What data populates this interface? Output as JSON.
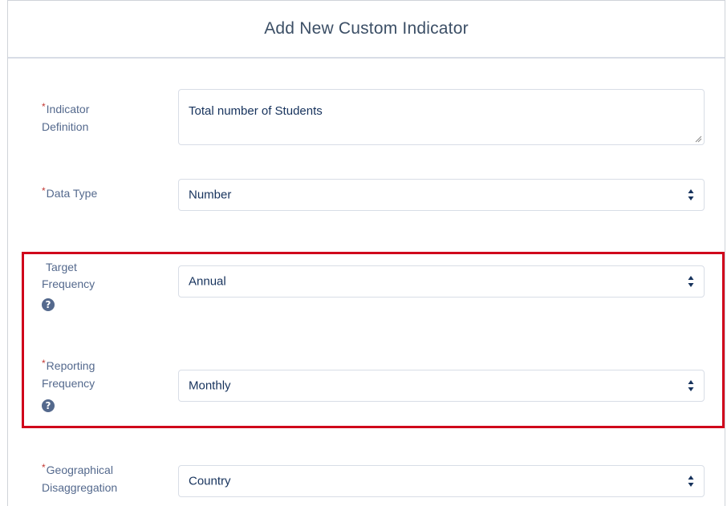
{
  "dialog": {
    "title": "Add New Custom Indicator"
  },
  "form": {
    "required_marker": "*",
    "indicator_definition": {
      "label_line1": "Indicator",
      "label_line2": "Definition",
      "value": "Total number of Students"
    },
    "data_type": {
      "label": "Data Type",
      "value": "Number"
    },
    "target_frequency": {
      "label_line1": "Target",
      "label_line2": "Frequency",
      "value": "Annual",
      "help_icon": "question-circle-icon"
    },
    "reporting_frequency": {
      "label_line1": "Reporting",
      "label_line2": "Frequency",
      "value": "Monthly",
      "help_icon": "question-circle-icon"
    },
    "geographical_disaggregation": {
      "label_line1": "Geographical",
      "label_line2": "Disaggregation",
      "value": "Country"
    }
  },
  "colors": {
    "highlight_border": "#d0021b",
    "required_marker": "#c23934",
    "label_text": "#54698d"
  }
}
